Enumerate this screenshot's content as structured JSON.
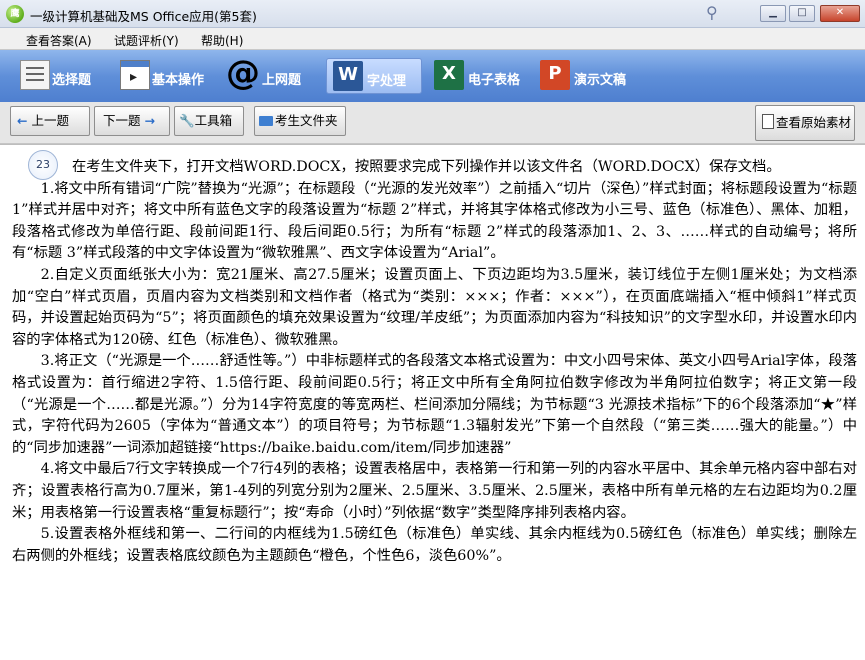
{
  "window": {
    "title": "一级计算机基础及MS Office应用(第5套)",
    "app_icon_text": "鹰"
  },
  "menu": {
    "items": [
      "查看答案(A)",
      "试题评析(Y)",
      "帮助(H)"
    ]
  },
  "tabs": {
    "items": [
      {
        "label": "选择题",
        "icon": "choice-icon"
      },
      {
        "label": "基本操作",
        "icon": "basic-op-icon"
      },
      {
        "label": "上网题",
        "icon": "at-icon"
      },
      {
        "label": "字处理",
        "icon": "word-icon",
        "active": true
      },
      {
        "label": "电子表格",
        "icon": "excel-icon"
      },
      {
        "label": "演示文稿",
        "icon": "ppt-icon"
      }
    ]
  },
  "toolbar": {
    "prev_label": "上一题",
    "next_label": "下一题",
    "tools_label": "工具箱",
    "folder_label": "考生文件夹",
    "view_label": "查看原始素材"
  },
  "question": {
    "number": "23",
    "intro": "在考生文件夹下，打开文档WORD.DOCX，按照要求完成下列操作并以该文件名（WORD.DOCX）保存文档。",
    "paragraphs": [
      "1.将文中所有错词“广院”替换为“光源”；在标题段（“光源的发光效率”）之前插入“切片（深色）”样式封面；将标题段设置为“标题 1”样式并居中对齐；将文中所有蓝色文字的段落设置为“标题 2”样式，并将其字体格式修改为小三号、蓝色（标准色）、黑体、加粗，段落格式修改为单倍行距、段前间距1行、段后间距0.5行；为所有“标题 2”样式的段落添加1、2、3、……样式的自动编号；将所有“标题 3”样式段落的中文字体设置为“微软雅黑”、西文字体设置为“Arial”。",
      "2.自定义页面纸张大小为：宽21厘米、高27.5厘米；设置页面上、下页边距均为3.5厘米，装订线位于左侧1厘米处；为文档添加“空白”样式页眉，页眉内容为文档类别和文档作者（格式为“类别：×××；作者：×××”），在页面底端插入“框中倾斜1”样式页码，并设置起始页码为“5”；将页面颜色的填充效果设置为“纹理/羊皮纸”；为页面添加内容为“科技知识”的文字型水印，并设置水印内容的字体格式为120磅、红色（标准色）、微软雅黑。",
      "3.将正文（“光源是一个……舒适性等。”）中非标题样式的各段落文本格式设置为：中文小四号宋体、英文小四号Arial字体，段落格式设置为：首行缩进2字符、1.5倍行距、段前间距0.5行；将正文中所有全角阿拉伯数字修改为半角阿拉伯数字；将正文第一段（“光源是一个……都是光源。”）分为14字符宽度的等宽两栏、栏间添加分隔线；为节标题“3 光源技术指标”下的6个段落添加“★”样式，字符代码为2605（字体为“普通文本”）的项目符号；为节标题“1.3辐射发光”下第一个自然段（“第三类……强大的能量。”）中的“同步加速器”一词添加超链接“https://baike.baidu.com/item/同步加速器”",
      "4.将文中最后7行文字转换成一个7行4列的表格；设置表格居中，表格第一行和第一列的内容水平居中、其余单元格内容中部右对齐；设置表格行高为0.7厘米，第1-4列的列宽分别为2厘米、2.5厘米、3.5厘米、2.5厘米，表格中所有单元格的左右边距均为0.2厘米；用表格第一行设置表格“重复标题行”；按“寿命（小时）”列依据“数字”类型降序排列表格内容。",
      "5.设置表格外框线和第一、二行间的内框线为1.5磅红色（标准色）单实线、其余内框线为0.5磅红色（标准色）单实线；删除左右两侧的外框线；设置表格底纹颜色为主题颜色“橙色，个性色6，淡色60%”。"
    ]
  }
}
